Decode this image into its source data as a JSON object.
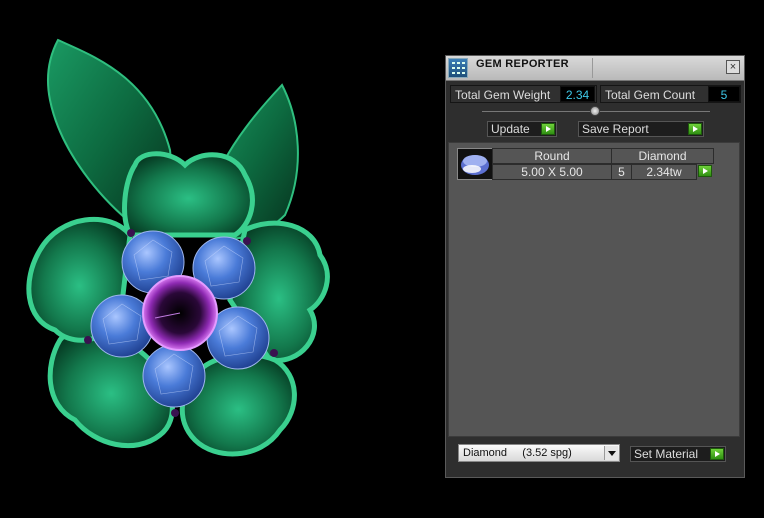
{
  "panel": {
    "title": "GEM REPORTER",
    "close_label": "×",
    "total_weight_label": "Total Gem Weight",
    "total_weight_value": "2.34",
    "total_count_label": "Total Gem Count",
    "total_count_value": "5",
    "update_label": "Update",
    "save_report_label": "Save Report",
    "gem_rows": [
      {
        "shape": "Round",
        "material": "Diamond",
        "size": "5.00 X 5.00",
        "count": "5",
        "weight": "2.34tw"
      }
    ],
    "material_select_value": "Diamond     (3.52 spg)",
    "set_material_label": "Set Material"
  },
  "colors": {
    "value_text": "#3ec8e8",
    "go_button": "#4cb424",
    "leaf_green": "#1f8a5a",
    "gem_blue": "#4a7bd8",
    "center_purple": "#9a2bbf"
  },
  "icons": [
    "gem-reporter-app-icon",
    "close-icon",
    "go-arrow-icon",
    "dropdown-arrow-icon",
    "round-gem-thumbnail-icon"
  ]
}
